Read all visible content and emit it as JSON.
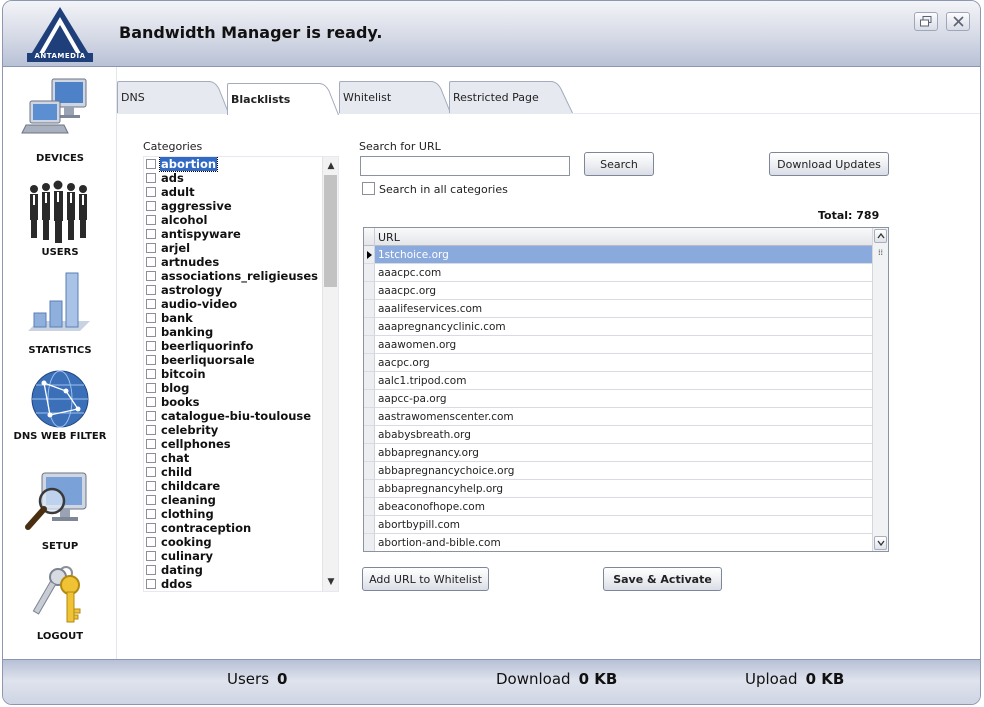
{
  "header": {
    "logo_text": "ANTAMEDIA",
    "status": "Bandwidth Manager is ready.",
    "restore_icon": "restore-icon",
    "close_icon": "close-icon"
  },
  "sidebar": {
    "items": [
      {
        "label": "DEVICES",
        "icon": "computer-icon"
      },
      {
        "label": "USERS",
        "icon": "people-icon"
      },
      {
        "label": "STATISTICS",
        "icon": "bar-chart-icon"
      },
      {
        "label": "DNS WEB FILTER",
        "icon": "globe-icon"
      },
      {
        "label": "SETUP",
        "icon": "monitor-magnifier-icon"
      },
      {
        "label": "LOGOUT",
        "icon": "keys-icon"
      }
    ]
  },
  "tabs": [
    {
      "label": "DNS",
      "active": false
    },
    {
      "label": "Blacklists",
      "active": true
    },
    {
      "label": "Whitelist",
      "active": false
    },
    {
      "label": "Restricted Page",
      "active": false
    }
  ],
  "categories": {
    "label": "Categories",
    "selected": "abortion",
    "items": [
      "abortion",
      "ads",
      "adult",
      "aggressive",
      "alcohol",
      "antispyware",
      "arjel",
      "artnudes",
      "associations_religieuses",
      "astrology",
      "audio-video",
      "bank",
      "banking",
      "beerliquorinfo",
      "beerliquorsale",
      "bitcoin",
      "blog",
      "books",
      "catalogue-biu-toulouse",
      "celebrity",
      "cellphones",
      "chat",
      "child",
      "childcare",
      "cleaning",
      "clothing",
      "contraception",
      "cooking",
      "culinary",
      "dating",
      "ddos"
    ]
  },
  "search": {
    "label": "Search for URL",
    "value": "",
    "button": "Search",
    "all_categories_label": "Search in all categories",
    "all_categories_checked": false
  },
  "download_updates": "Download Updates",
  "total": "Total: 789",
  "grid": {
    "header": "URL",
    "selected": "1stchoice.org",
    "rows": [
      "1stchoice.org",
      "aaacpc.com",
      "aaacpc.org",
      "aaalifeservices.com",
      "aaapregnancyclinic.com",
      "aaawomen.org",
      "aacpc.org",
      "aalc1.tripod.com",
      "aapcc-pa.org",
      "aastrawomenscenter.com",
      "ababysbreath.org",
      "abbapregnancy.org",
      "abbapregnancychoice.org",
      "abbapregnancyhelp.org",
      "abeaconofhope.com",
      "abortbypill.com",
      "abortion-and-bible.com"
    ]
  },
  "actions": {
    "add_whitelist": "Add URL to Whitelist",
    "save": "Save & Activate"
  },
  "footer": {
    "users_label": "Users",
    "users_value": "0",
    "download_label": "Download",
    "download_value": "0 KB",
    "upload_label": "Upload",
    "upload_value": "0 KB"
  },
  "colors": {
    "accent": "#316ac5",
    "selected_row": "#8aa9dd",
    "header_top": "#f3f4f8",
    "header_bottom": "#b9c1d6"
  }
}
